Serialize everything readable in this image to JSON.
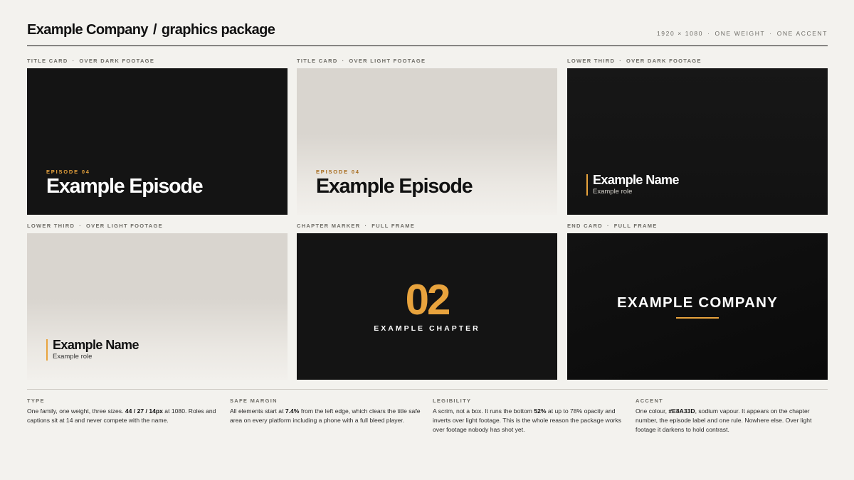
{
  "header": {
    "company": "Example Company",
    "separator": "/",
    "subtitle": "graphics package",
    "meta": [
      "1920 × 1080",
      "ONE WEIGHT",
      "ONE ACCENT"
    ]
  },
  "accent_color": "#E8A33D",
  "cards": [
    {
      "label_type": "TITLE CARD",
      "label_context": "OVER DARK FOOTAGE",
      "episode_label": "EPISODE 04",
      "episode_title": "Example Episode"
    },
    {
      "label_type": "TITLE CARD",
      "label_context": "OVER LIGHT FOOTAGE",
      "episode_label": "EPISODE 04",
      "episode_title": "Example Episode"
    },
    {
      "label_type": "LOWER THIRD",
      "label_context": "OVER DARK FOOTAGE",
      "name": "Example Name",
      "role": "Example role"
    },
    {
      "label_type": "LOWER THIRD",
      "label_context": "OVER LIGHT FOOTAGE",
      "name": "Example Name",
      "role": "Example role"
    },
    {
      "label_type": "CHAPTER MARKER",
      "label_context": "FULL FRAME",
      "chapter_number": "02",
      "chapter_name": "EXAMPLE CHAPTER"
    },
    {
      "label_type": "END CARD",
      "label_context": "FULL FRAME",
      "company": "EXAMPLE COMPANY"
    }
  ],
  "notes": [
    {
      "heading": "TYPE",
      "parts": [
        "One family, one weight, three sizes. ",
        "44 / 27 / 14px",
        " at 1080. Roles and captions sit at 14 and never compete with the name."
      ]
    },
    {
      "heading": "SAFE MARGIN",
      "parts": [
        "All elements start at ",
        "7.4%",
        " from the left edge, which clears the title safe area on every platform including a phone with a full bleed player."
      ]
    },
    {
      "heading": "LEGIBILITY",
      "parts": [
        "A scrim, not a box. It runs the bottom ",
        "52%",
        " at up to 78% opacity and inverts over light footage. This is the whole reason the package works over footage nobody has shot yet."
      ]
    },
    {
      "heading": "ACCENT",
      "parts": [
        "One colour, ",
        "#E8A33D",
        ", sodium vapour. It appears on the chapter number, the episode label and one rule. Nowhere else. Over light footage it darkens to hold contrast."
      ]
    }
  ]
}
